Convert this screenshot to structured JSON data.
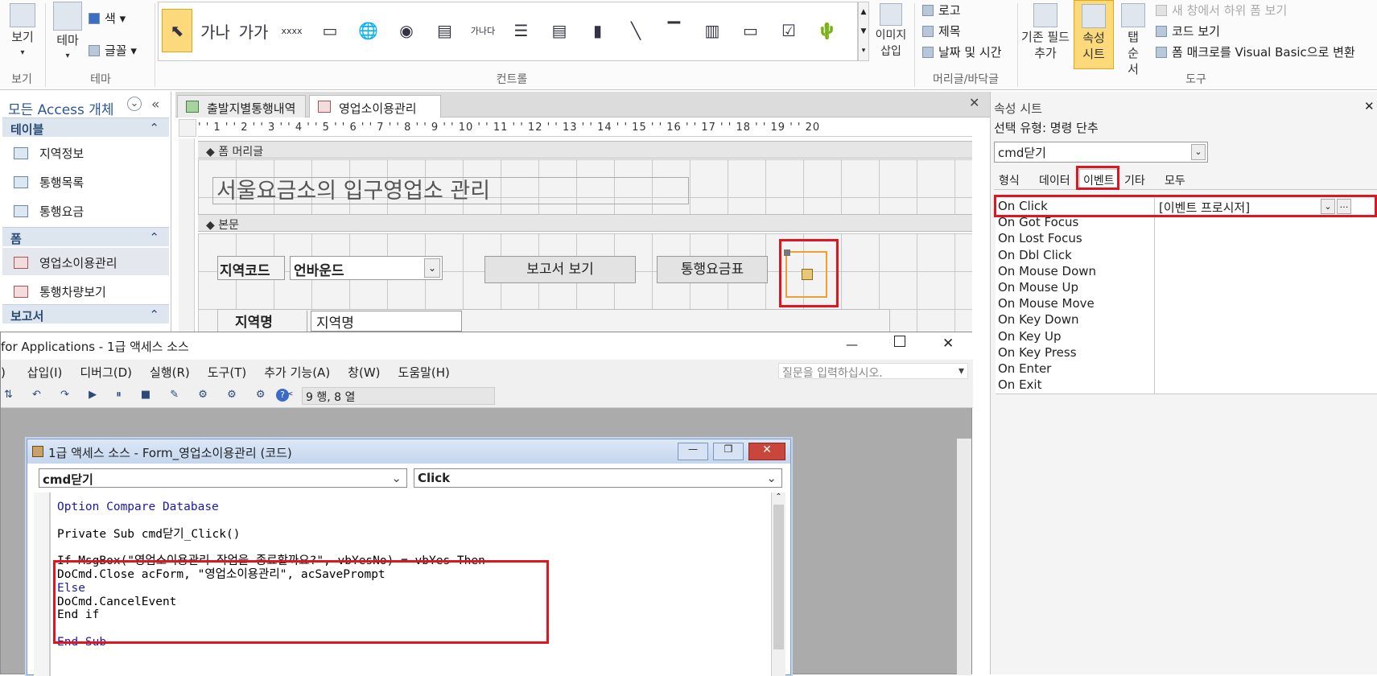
{
  "ribbon": {
    "view": {
      "label": "보기",
      "sub": "보기"
    },
    "theme": {
      "label": "테마",
      "color": "색",
      "font": "글꼴",
      "group": "테마"
    },
    "controls_group": "컨트롤",
    "insert_image": "이미지 삽입",
    "header_footer": {
      "logo": "로고",
      "title": "제목",
      "datetime": "날짜 및 시간",
      "group": "머리글/바닥글"
    },
    "tools": {
      "add_field": "기존 필드 추가",
      "property_sheet": "속성 시트",
      "tab_order": "탭 순서",
      "subform": "새 창에서 하위 폼 보기",
      "view_code": "코드 보기",
      "convert_macro": "폼 매크로를 Visual Basic으로 변환",
      "group": "도구"
    },
    "controls": [
      {
        "icon": "pointer-icon",
        "glyph": "⬉"
      },
      {
        "icon": "label-icon",
        "glyph": "가나"
      },
      {
        "icon": "textbox-icon",
        "glyph": "가가"
      },
      {
        "icon": "button-icon",
        "glyph": "xxxx"
      },
      {
        "icon": "tab-control-icon",
        "glyph": "▭"
      },
      {
        "icon": "hyperlink-icon",
        "glyph": "🌐"
      },
      {
        "icon": "web-browser-icon",
        "glyph": "◉"
      },
      {
        "icon": "navigation-control-icon",
        "glyph": "▤"
      },
      {
        "icon": "option-group-icon",
        "glyph": "가나다"
      },
      {
        "icon": "page-break-icon",
        "glyph": "☰"
      },
      {
        "icon": "combo-box-icon",
        "glyph": "▤"
      },
      {
        "icon": "chart-icon",
        "glyph": "▮"
      },
      {
        "icon": "line-icon",
        "glyph": "╲"
      },
      {
        "icon": "toggle-button-icon",
        "glyph": "▔"
      },
      {
        "icon": "list-box-icon",
        "glyph": "▥"
      },
      {
        "icon": "rectangle-icon",
        "glyph": "▭"
      },
      {
        "icon": "check-box-icon",
        "glyph": "☑"
      },
      {
        "icon": "unbound-object-icon",
        "glyph": "🌵"
      }
    ]
  },
  "nav": {
    "title": "모든 Access 개체",
    "sections": [
      {
        "label": "테이블",
        "items": [
          "지역정보",
          "통행목록",
          "통행요금"
        ]
      },
      {
        "label": "폼",
        "items": [
          "영업소이용관리",
          "통행차량보기"
        ]
      },
      {
        "label": "보고서",
        "items": []
      }
    ]
  },
  "doc_tabs": [
    "출발지별통행내역",
    "영업소이용관리"
  ],
  "ruler": "' ' 1 ' ' 2 ' ' 3 ' ' 4 ' ' 5 ' ' 6 ' ' 7 ' ' 8 ' ' 9 ' ' 10 ' ' 11 ' ' 12 ' ' 13 ' ' 14 ' ' 15 ' ' 16 ' ' 17 ' ' 18 ' ' 19 ' ' 20",
  "form": {
    "header_band": "폼 머리글",
    "title": "서울요금소의 입구영업소 관리",
    "detail_band": "본문",
    "region_code_label": "지역코드",
    "region_combo": "언바운드",
    "report_button": "보고서 보기",
    "toll_button": "통행요금표",
    "region_name_label": "지역명",
    "region_name_field": "지역명"
  },
  "props": {
    "title": "속성 시트",
    "selection_type": "선택 유형: 명령 단추",
    "object": "cmd닫기",
    "tabs": [
      "형식",
      "데이터",
      "이벤트",
      "기타",
      "모두"
    ],
    "active_tab": "이벤트",
    "rows": [
      {
        "name": "On Click",
        "value": "[이벤트 프로시저]"
      },
      {
        "name": "On Got Focus",
        "value": ""
      },
      {
        "name": "On Lost Focus",
        "value": ""
      },
      {
        "name": "On Dbl Click",
        "value": ""
      },
      {
        "name": "On Mouse Down",
        "value": ""
      },
      {
        "name": "On Mouse Up",
        "value": ""
      },
      {
        "name": "On Mouse Move",
        "value": ""
      },
      {
        "name": "On Key Down",
        "value": ""
      },
      {
        "name": "On Key Up",
        "value": ""
      },
      {
        "name": "On Key Press",
        "value": ""
      },
      {
        "name": "On Enter",
        "value": ""
      },
      {
        "name": "On Exit",
        "value": ""
      }
    ]
  },
  "vba": {
    "title": "for Applications - 1급 액세스 소스",
    "menu": [
      "삽입(I)",
      "디버그(D)",
      "실행(R)",
      "도구(T)",
      "추가 기능(A)",
      "창(W)",
      "도움말(H)"
    ],
    "question_placeholder": "질문을 입력하십시오.",
    "position": "9 행, 8 열",
    "code_window_title": "1급 액세스 소스 - Form_영업소이용관리 (코드)",
    "object_combo": "cmd닫기",
    "proc_combo": "Click",
    "code": [
      {
        "text": "Option Compare Database",
        "kw": true
      },
      {
        "text": "",
        "kw": false
      },
      {
        "text": "Private Sub cmd닫기_Click()",
        "kw": false
      },
      {
        "text": "",
        "kw": false
      },
      {
        "text": "If MsgBox(\"영업소이용관리 작업을 종료할까요?\", vbYesNo) = vbYes Then",
        "kw": false
      },
      {
        "text": "DoCmd.Close acForm, \"영업소이용관리\", acSavePrompt",
        "kw": false
      },
      {
        "text": "Else",
        "kw": true
      },
      {
        "text": "DoCmd.CancelEvent",
        "kw": false
      },
      {
        "text": "End if",
        "kw": false
      },
      {
        "text": "",
        "kw": false
      },
      {
        "text": "End Sub",
        "kw": true
      }
    ]
  }
}
